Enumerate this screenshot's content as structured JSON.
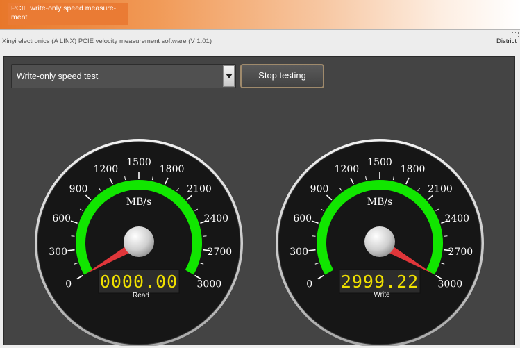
{
  "banner": {
    "title": "PCIE write-only speed measure-ment"
  },
  "window": {
    "title": "Xinyi electronics (A LINX) PCIE velocity measurement software (V 1.01)",
    "corner_label": "District"
  },
  "toolbar": {
    "mode_value": "Write-only speed test",
    "stop_label": "Stop testing"
  },
  "gauge_scale": {
    "min": 0,
    "max": 3000,
    "step": 300,
    "ticks": [
      "0",
      "300",
      "600",
      "900",
      "1200",
      "1500",
      "1800",
      "2100",
      "2400",
      "2700",
      "3000"
    ],
    "unit": "MB/s"
  },
  "gauges": [
    {
      "id": "read",
      "label": "Read",
      "value": 0,
      "display": "0000.00"
    },
    {
      "id": "write",
      "label": "Write",
      "value": 2999.22,
      "display": "2999.22"
    }
  ],
  "colors": {
    "arc": "#11e600",
    "needle": "#e0363a",
    "lcd_text": "#f0e000",
    "panel": "#444444",
    "bezel": "#d8d8d8"
  }
}
